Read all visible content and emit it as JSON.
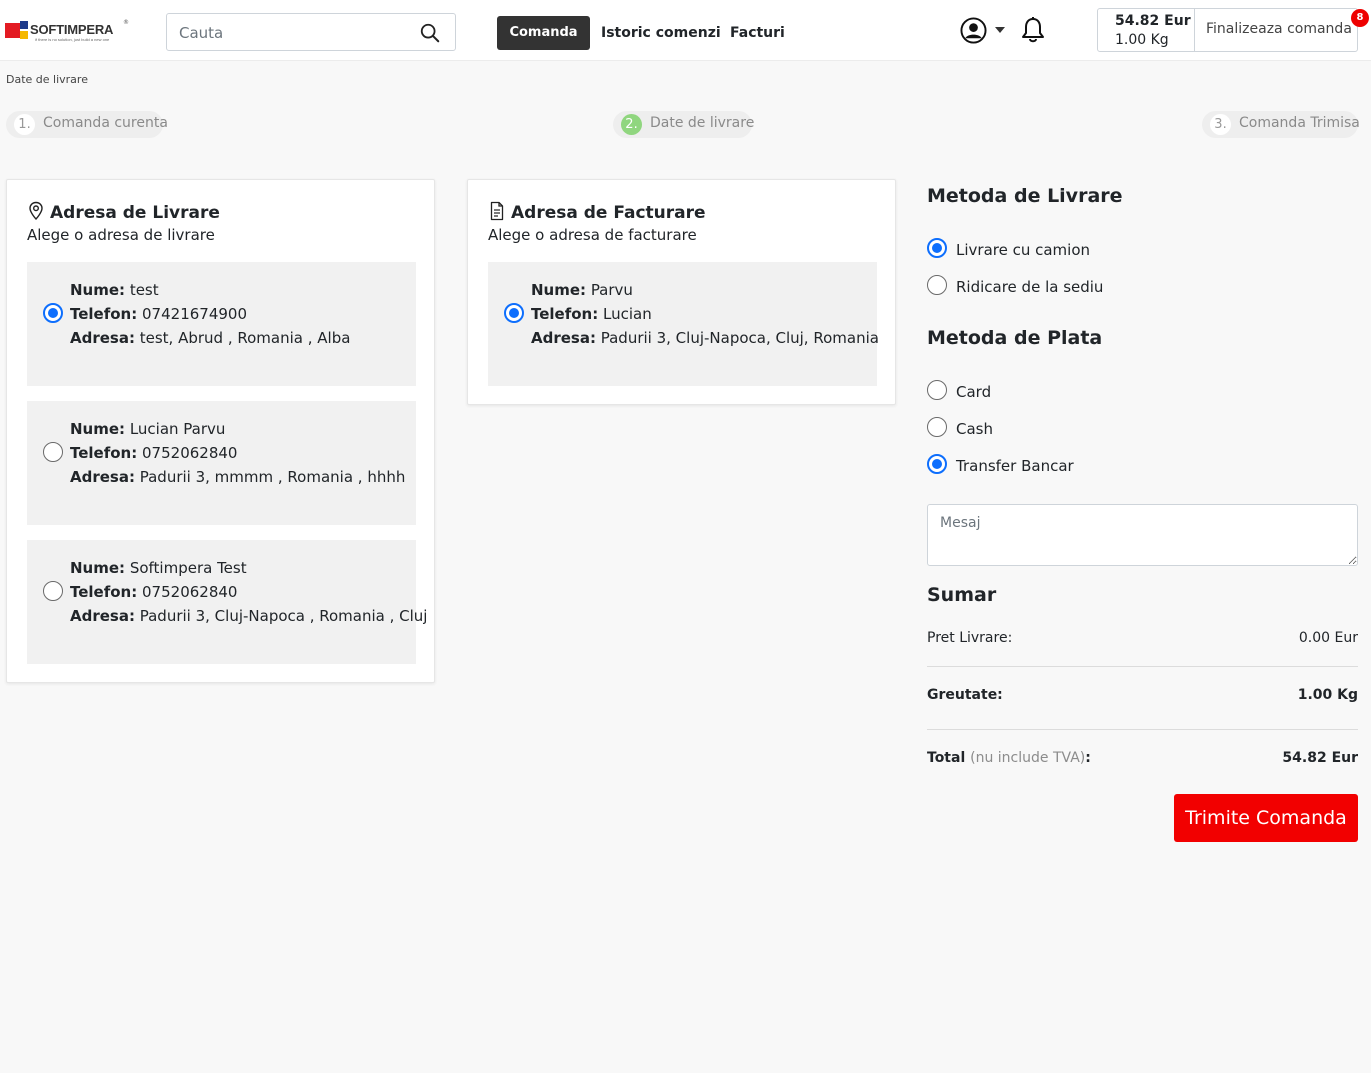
{
  "header": {
    "logo": {
      "name": "SOFTIMPERA",
      "tagline": "if there is no solution, just build a new one",
      "reg": "®"
    },
    "search": {
      "placeholder": "Cauta",
      "value": ""
    },
    "nav": {
      "comanda": "Comanda",
      "istoric": "Istoric comenzi",
      "facturi": "Facturi"
    },
    "cart": {
      "total_eur": "54.82 Eur",
      "total_kg": "1.00 Kg",
      "finalize_label": "Finalizeaza comanda",
      "badge_count": "8"
    }
  },
  "breadcrumb": "Date de livrare",
  "steps": [
    {
      "num": "1.",
      "label": "Comanda curenta",
      "active": false
    },
    {
      "num": "2.",
      "label": "Date de livrare",
      "active": true
    },
    {
      "num": "3.",
      "label": "Comanda Trimisa",
      "active": false
    }
  ],
  "livrare": {
    "title": "Adresa de Livrare",
    "subtitle": "Alege o adresa de livrare",
    "addresses": [
      {
        "nume_label": "Nume:",
        "nume": " test",
        "tel_label": "Telefon:",
        "tel": " 07421674900",
        "adresa_label": "Adresa:",
        "adresa": " test, Abrud , Romania , Alba",
        "selected": true
      },
      {
        "nume_label": "Nume:",
        "nume": " Lucian Parvu",
        "tel_label": "Telefon:",
        "tel": " 0752062840",
        "adresa_label": "Adresa:",
        "adresa": " Padurii 3, mmmm , Romania , hhhh",
        "selected": false
      },
      {
        "nume_label": "Nume:",
        "nume": " Softimpera Test",
        "tel_label": "Telefon:",
        "tel": " 0752062840",
        "adresa_label": "Adresa:",
        "adresa": " Padurii 3, Cluj-Napoca , Romania , Cluj",
        "selected": false
      }
    ]
  },
  "facturare": {
    "title": "Adresa de Facturare",
    "subtitle": "Alege o adresa de facturare",
    "addresses": [
      {
        "nume_label": "Nume:",
        "nume": " Parvu",
        "tel_label": "Telefon:",
        "tel": " Lucian",
        "adresa_label": "Adresa:",
        "adresa": " Padurii 3, Cluj-Napoca, Cluj, Romania",
        "selected": true
      }
    ]
  },
  "metoda_livrare": {
    "title": "Metoda de Livrare",
    "options": [
      {
        "label": "Livrare cu camion",
        "selected": true
      },
      {
        "label": "Ridicare de la sediu",
        "selected": false
      }
    ]
  },
  "metoda_plata": {
    "title": "Metoda de Plata",
    "options": [
      {
        "label": "Card",
        "selected": false
      },
      {
        "label": "Cash",
        "selected": false
      },
      {
        "label": "Transfer Bancar",
        "selected": true
      }
    ]
  },
  "mesaj": {
    "placeholder": "Mesaj",
    "value": ""
  },
  "sumar": {
    "title": "Sumar",
    "pret_livrare_label": "Pret Livrare:",
    "pret_livrare_value": "0.00 Eur",
    "greutate_label": "Greutate:",
    "greutate_value": "1.00 Kg",
    "total_label": "Total",
    "total_note": "(nu include TVA)",
    "total_colon": ":",
    "total_value": "54.82 Eur"
  },
  "submit_label": "Trimite Comanda",
  "colors": {
    "accent": "#0d6efd",
    "submit": "#f20000",
    "nav_active": "#333333",
    "step_active": "#90d67f",
    "badge": "#ee0000"
  }
}
